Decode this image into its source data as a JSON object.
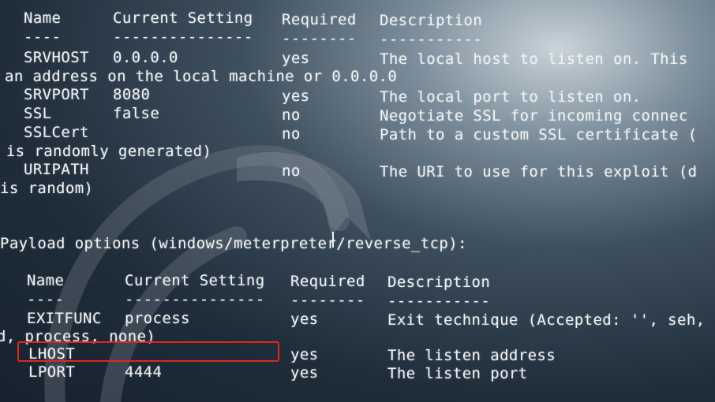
{
  "module_options": {
    "header": {
      "name": "Name",
      "current_setting": "Current Setting",
      "required": "Required",
      "description": "Description"
    },
    "underline": {
      "name": "----",
      "current_setting": "---------------",
      "required": "--------",
      "description": "-----------"
    },
    "rows": [
      {
        "name": "SRVHOST",
        "current_setting": "0.0.0.0",
        "required": "yes",
        "description": "The local host to listen on. This",
        "continuation": "an address on the local machine or 0.0.0.0"
      },
      {
        "name": "SRVPORT",
        "current_setting": "8080",
        "required": "yes",
        "description": "The local port to listen on."
      },
      {
        "name": "SSL",
        "current_setting": "false",
        "required": "no",
        "description": "Negotiate SSL for incoming connec"
      },
      {
        "name": "SSLCert",
        "current_setting": "",
        "required": "no",
        "description": "Path to a custom SSL certificate (",
        "continuation": " is randomly generated)"
      },
      {
        "name": "URIPATH",
        "current_setting": "",
        "required": "no",
        "description": "The URI to use for this exploit (d",
        "continuation": "is random)"
      }
    ]
  },
  "payload_title": "Payload options (windows/meterpreter/reverse_tcp):",
  "payload_options": {
    "header": {
      "name": "Name",
      "current_setting": "Current Setting",
      "required": "Required",
      "description": "Description"
    },
    "underline": {
      "name": "----",
      "current_setting": "---------------",
      "required": "--------",
      "description": "-----------"
    },
    "rows": [
      {
        "name": "EXITFUNC",
        "current_setting": "process",
        "required": "yes",
        "description": "Exit technique (Accepted: '', seh,",
        "continuation": "d, process, none)"
      },
      {
        "name": "LHOST",
        "current_setting": "",
        "required": "yes",
        "description": "The listen address"
      },
      {
        "name": "LPORT",
        "current_setting": "4444",
        "required": "yes",
        "description": "The listen port"
      }
    ]
  },
  "highlight_color": "#e0261f"
}
